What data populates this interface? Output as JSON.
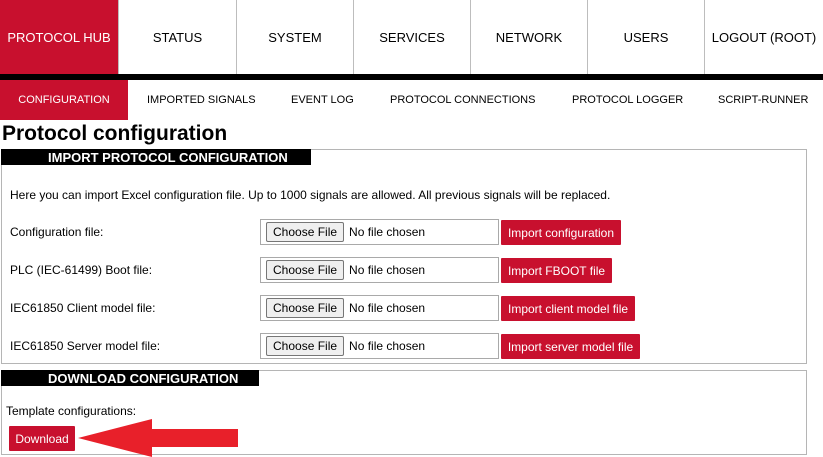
{
  "top_nav": [
    {
      "label": "PROTOCOL HUB",
      "active": true
    },
    {
      "label": "STATUS"
    },
    {
      "label": "SYSTEM"
    },
    {
      "label": "SERVICES"
    },
    {
      "label": "NETWORK"
    },
    {
      "label": "USERS"
    },
    {
      "label": "LOGOUT (ROOT)"
    }
  ],
  "sub_nav": [
    {
      "label": "CONFIGURATION",
      "active": true
    },
    {
      "label": "IMPORTED SIGNALS"
    },
    {
      "label": "EVENT LOG"
    },
    {
      "label": "PROTOCOL CONNECTIONS"
    },
    {
      "label": "PROTOCOL LOGGER"
    },
    {
      "label": "SCRIPT-RUNNER"
    }
  ],
  "page_title": "Protocol configuration",
  "import_section": {
    "header": "IMPORT PROTOCOL CONFIGURATION",
    "intro": "Here you can import Excel configuration file. Up to 1000 signals are allowed. All previous signals will be replaced.",
    "choose_label": "Choose File",
    "no_file": "No file chosen",
    "rows": [
      {
        "label": "Configuration file:",
        "button": "Import configuration"
      },
      {
        "label": "PLC (IEC-61499) Boot file:",
        "button": "Import FBOOT file"
      },
      {
        "label": "IEC61850 Client model file:",
        "button": "Import client model file"
      },
      {
        "label": "IEC61850 Server model file:",
        "button": "Import server model file"
      }
    ]
  },
  "download_section": {
    "header": "DOWNLOAD CONFIGURATION",
    "template_label": "Template configurations:",
    "download_button": "Download"
  },
  "colors": {
    "accent": "#c8102e",
    "arrow": "#e8202a",
    "header_bg": "#000000"
  }
}
